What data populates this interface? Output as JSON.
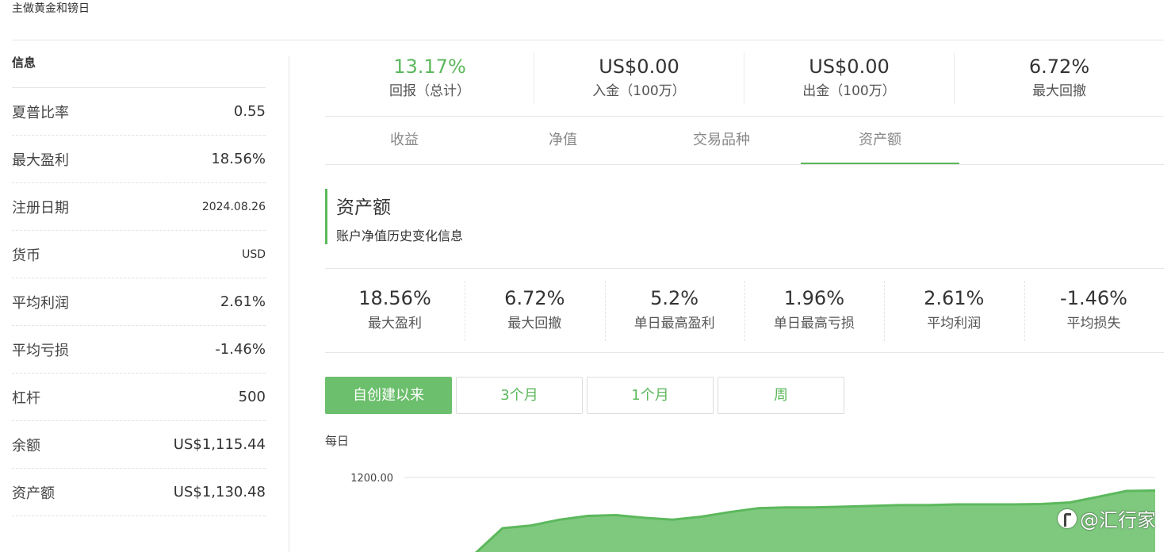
{
  "header": {
    "description": "主做黄金和镑日"
  },
  "sidebar": {
    "title": "信息",
    "rows": [
      {
        "label": "夏普比率",
        "value": "0.55"
      },
      {
        "label": "最大盈利",
        "value": "18.56%"
      },
      {
        "label": "注册日期",
        "value": "2024.08.26"
      },
      {
        "label": "货币",
        "value": "USD"
      },
      {
        "label": "平均利润",
        "value": "2.61%"
      },
      {
        "label": "平均亏损",
        "value": "-1.46%"
      },
      {
        "label": "杠杆",
        "value": "500"
      },
      {
        "label": "余额",
        "value": "US$1,115.44"
      },
      {
        "label": "资产额",
        "value": "US$1,130.48"
      }
    ]
  },
  "stats": [
    {
      "value": "13.17%",
      "label": "回报（总计）",
      "color": "#5cb85c"
    },
    {
      "value": "US$0.00",
      "label": "入金（100万）"
    },
    {
      "value": "US$0.00",
      "label": "出金（100万）"
    },
    {
      "value": "6.72%",
      "label": "最大回撤"
    }
  ],
  "tabs": [
    {
      "label": "收益",
      "active": false
    },
    {
      "label": "净值",
      "active": false
    },
    {
      "label": "交易品种",
      "active": false
    },
    {
      "label": "资产额",
      "active": true
    }
  ],
  "section": {
    "title": "资产额",
    "subtitle": "账户净值历史变化信息"
  },
  "metrics": [
    {
      "value": "18.56%",
      "label": "最大盈利"
    },
    {
      "value": "6.72%",
      "label": "最大回撤"
    },
    {
      "value": "5.2%",
      "label": "单日最高盈利"
    },
    {
      "value": "1.96%",
      "label": "单日最高亏损"
    },
    {
      "value": "2.61%",
      "label": "平均利润"
    },
    {
      "value": "-1.46%",
      "label": "平均损失"
    }
  ],
  "periods": [
    {
      "label": "自创建以来",
      "active": true
    },
    {
      "label": "3个月",
      "active": false
    },
    {
      "label": "1个月",
      "active": false
    },
    {
      "label": "周",
      "active": false
    }
  ],
  "colors": {
    "accent": "#5cb85c",
    "area_fill": "#7fc97f",
    "area_line": "#5cb85c"
  },
  "chart": {
    "frequency_label": "每日",
    "y_tick_label": "1200.00"
  },
  "chart_data": {
    "type": "area",
    "title": "",
    "xlabel": "",
    "ylabel": "",
    "y_ticks": [
      1200
    ],
    "grid": true,
    "series": [
      {
        "values": [
          1000,
          1068,
          1075,
          1090,
          1100,
          1102,
          1095,
          1090,
          1098,
          1110,
          1120,
          1122,
          1122,
          1124,
          1126,
          1128,
          1128,
          1130,
          1130,
          1130,
          1131,
          1135,
          1150,
          1165,
          1166
        ]
      }
    ]
  },
  "watermark": {
    "text": "@汇行家"
  }
}
